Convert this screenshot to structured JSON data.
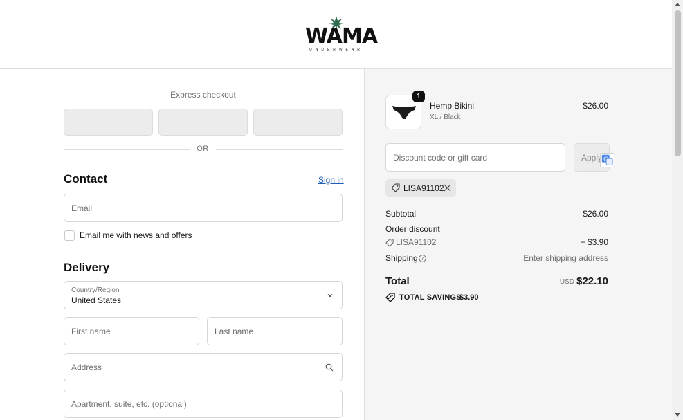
{
  "header": {
    "logo_text": "WAMA",
    "logo_subtext": "UNDERWEAR"
  },
  "express": {
    "title": "Express checkout",
    "or_label": "OR"
  },
  "contact": {
    "title": "Contact",
    "sign_in_label": "Sign in",
    "email_placeholder": "Email",
    "newsletter_label": "Email me with news and offers"
  },
  "delivery": {
    "title": "Delivery",
    "country_label": "Country/Region",
    "country_value": "United States",
    "first_name_placeholder": "First name",
    "last_name_placeholder": "Last name",
    "address_placeholder": "Address",
    "apartment_placeholder": "Apartment, suite, etc. (optional)"
  },
  "summary": {
    "product": {
      "quantity": "1",
      "name": "Hemp Bikini",
      "variant": "XL / Black",
      "price": "$26.00"
    },
    "discount_placeholder": "Discount code or gift card",
    "apply_label": "Apply",
    "applied_code": "LISA91102",
    "subtotal_label": "Subtotal",
    "subtotal_value": "$26.00",
    "order_discount_label": "Order discount",
    "order_discount_code": "LISA91102",
    "order_discount_value": "− $3.90",
    "shipping_label": "Shipping",
    "shipping_value": "Enter shipping address",
    "total_label": "Total",
    "total_currency": "USD",
    "total_value": "$22.10",
    "savings_label": "TOTAL SAVINGS",
    "savings_value": "$3.90"
  },
  "colors": {
    "link": "#1f5fb3",
    "logo_leaf": "#2e6b4f",
    "summary_bg": "#f5f5f5"
  }
}
